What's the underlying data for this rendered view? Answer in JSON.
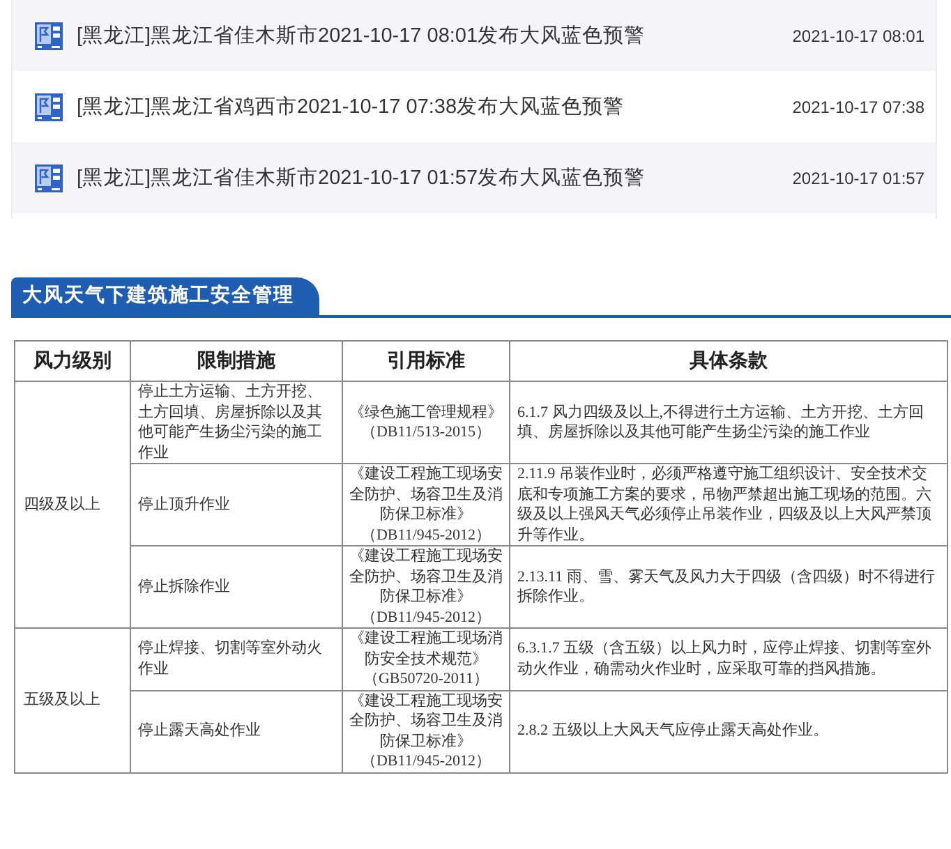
{
  "warnings": [
    {
      "title": "[黑龙江]黑龙江省佳木斯市2021-10-17 08:01发布大风蓝色预警",
      "time": "2021-10-17 08:01"
    },
    {
      "title": "[黑龙江]黑龙江省鸡西市2021-10-17 07:38发布大风蓝色预警",
      "time": "2021-10-17 07:38"
    },
    {
      "title": "[黑龙江]黑龙江省佳木斯市2021-10-17 01:57发布大风蓝色预警",
      "time": "2021-10-17 01:57"
    }
  ],
  "section_title": "大风天气下建筑施工安全管理",
  "table": {
    "columns": [
      "风力级别",
      "限制措施",
      "引用标准",
      "具体条款"
    ],
    "groups": [
      {
        "level": "四级及以上",
        "rows": [
          {
            "measure": "停止土方运输、土方开挖、土方回填、房屋拆除以及其他可能产生扬尘污染的施工作业",
            "standard": "《绿色施工管理规程》（DB11/513-2015）",
            "clause": "6.1.7 风力四级及以上,不得进行土方运输、土方开挖、土方回填、房屋拆除以及其他可能产生扬尘污染的施工作业"
          },
          {
            "measure": "停止顶升作业",
            "standard": "《建设工程施工现场安全防护、场容卫生及消防保卫标准》（DB11/945-2012）",
            "clause": "2.11.9 吊装作业时，必须严格遵守施工组织设计、安全技术交底和专项施工方案的要求，吊物严禁超出施工现场的范围。六级及以上强风天气必须停止吊装作业，四级及以上大风严禁顶升等作业。"
          },
          {
            "measure": "停止拆除作业",
            "standard": "《建设工程施工现场安全防护、场容卫生及消防保卫标准》（DB11/945-2012）",
            "clause": "2.13.11 雨、雪、雾天气及风力大于四级（含四级）时不得进行拆除作业。"
          }
        ]
      },
      {
        "level": "五级及以上",
        "rows": [
          {
            "measure": "停止焊接、切割等室外动火作业",
            "standard": "《建设工程施工现场消防安全技术规范》（GB50720-2011）",
            "clause": "6.3.1.7 五级（含五级）以上风力时，应停止焊接、切割等室外动火作业，确需动火作业时，应采取可靠的挡风措施。"
          },
          {
            "measure": "停止露天高处作业",
            "standard": "《建设工程施工现场安全防护、场容卫生及消防保卫标准》（DB11/945-2012）",
            "clause": "2.8.2 五级以上大风天气应停止露天高处作业。"
          }
        ]
      }
    ]
  }
}
